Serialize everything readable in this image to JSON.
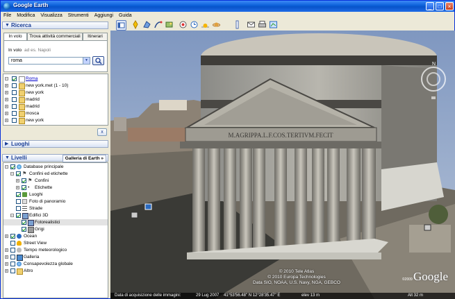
{
  "window": {
    "title": "Google Earth",
    "minimize": "_",
    "maximize": "□",
    "close": "×"
  },
  "menu": [
    "File",
    "Modifica",
    "Visualizza",
    "Strumenti",
    "Aggiungi",
    "Guida"
  ],
  "search": {
    "header": "Ricerca",
    "tabs": [
      "In volo",
      "Trova attività commerciali",
      "Itinerari"
    ],
    "hint_prefix": "In volo",
    "hint_example": "ad es. Napoli",
    "input_value": "roma",
    "clear_label": "x"
  },
  "results": [
    {
      "label": "Roma",
      "checked": true,
      "link": true
    },
    {
      "label": "new york.met (1 - 10)",
      "checked": false,
      "link": false
    },
    {
      "label": "new york",
      "checked": false,
      "link": false
    },
    {
      "label": "madrid",
      "checked": false,
      "link": false
    },
    {
      "label": "madrid",
      "checked": false,
      "link": false
    },
    {
      "label": "mosca",
      "checked": false,
      "link": false
    },
    {
      "label": "new york",
      "checked": false,
      "link": false
    }
  ],
  "places": {
    "header": "Luoghi"
  },
  "layers": {
    "header": "Livelli",
    "gallery_button": "Galleria di Earth",
    "items": [
      {
        "label": "Database principale",
        "level": 0,
        "checked": true
      },
      {
        "label": "Confini ed etichette",
        "level": 1,
        "checked": true
      },
      {
        "label": "Confini",
        "level": 2,
        "checked": true
      },
      {
        "label": "Etichette",
        "level": 2,
        "checked": true
      },
      {
        "label": "Luoghi",
        "level": 1,
        "checked": true
      },
      {
        "label": "Foto di panoramio",
        "level": 1,
        "checked": false
      },
      {
        "label": "Strade",
        "level": 1,
        "checked": false
      },
      {
        "label": "Edifici 3D",
        "level": 1,
        "checked": true
      },
      {
        "label": "Fotorealistici",
        "level": 2,
        "checked": true,
        "selected": true
      },
      {
        "label": "Grigi",
        "level": 2,
        "checked": true
      },
      {
        "label": "Ocean",
        "level": 1,
        "checked": true
      },
      {
        "label": "Street View",
        "level": 1,
        "checked": false
      },
      {
        "label": "Tempo meteorologico",
        "level": 1,
        "checked": false
      },
      {
        "label": "Galleria",
        "level": 1,
        "checked": false
      },
      {
        "label": "Consapevolezza globale",
        "level": 1,
        "checked": false
      },
      {
        "label": "Altro",
        "level": 1,
        "checked": false
      }
    ]
  },
  "viewer": {
    "inscription": "M.AGRIPPA.L.F.COS.TERTIVM.FECIT",
    "credits": [
      "© 2010 Tele Atlas",
      "© 2010 Europa Technologies",
      "Data SIO, NOAA, U.S. Navy, NGA, GEBCO"
    ],
    "logo": "Google",
    "copyright_small": "©2009",
    "north": "N",
    "status_date_label": "Data di acquisizione delle immagini:",
    "status_date": "29 Lug 2007",
    "status_coords": "41°53'56.48\" N  12°28'35.47\" E",
    "status_elev": "elev  13 m",
    "status_alt": "Alt  32 m"
  },
  "colors": {
    "accent": "#1c3f95",
    "titlebar": "#0a5fd8",
    "sky": "#8fa6c9"
  }
}
